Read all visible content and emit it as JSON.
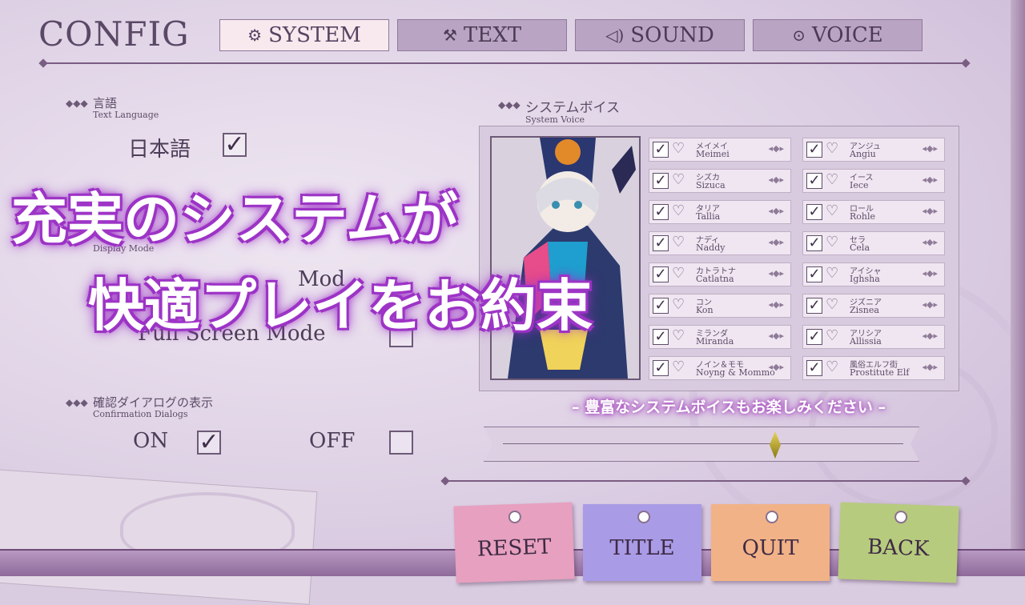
{
  "header": {
    "title": "CONFIG",
    "tabs": [
      {
        "label": "SYSTEM",
        "icon": "gear-icon",
        "active": true
      },
      {
        "label": "TEXT",
        "icon": "hammer-icon",
        "active": false
      },
      {
        "label": "SOUND",
        "icon": "speaker-icon",
        "active": false
      },
      {
        "label": "VOICE",
        "icon": "gamepad-icon",
        "active": false
      }
    ]
  },
  "language": {
    "title_jp": "言語",
    "title_en": "Text Language",
    "option": "日本語",
    "checked": true
  },
  "display": {
    "title_en": "Display Mode",
    "window_partial": "Mod",
    "fullscreen": "Full Screen Mode",
    "fullscreen_checked": false
  },
  "confirm": {
    "title_jp": "確認ダイアログの表示",
    "title_en": "Confirmation Dialogs",
    "on": "ON",
    "off": "OFF",
    "on_checked": true,
    "off_checked": false
  },
  "system_voice": {
    "title_jp": "システムボイス",
    "title_en": "System Voice",
    "items": [
      {
        "jp": "メイメイ",
        "en": "Meimei"
      },
      {
        "jp": "アンジュ",
        "en": "Angiu"
      },
      {
        "jp": "シズカ",
        "en": "Sizuca"
      },
      {
        "jp": "イース",
        "en": "Iece"
      },
      {
        "jp": "タリア",
        "en": "Tallia"
      },
      {
        "jp": "ロール",
        "en": "Rohle"
      },
      {
        "jp": "ナディ",
        "en": "Naddy"
      },
      {
        "jp": "セラ",
        "en": "Cela"
      },
      {
        "jp": "カトラトナ",
        "en": "Catlatna"
      },
      {
        "jp": "アイシャ",
        "en": "Ighsha"
      },
      {
        "jp": "コン",
        "en": "Kon"
      },
      {
        "jp": "ジズニア",
        "en": "Zisnea"
      },
      {
        "jp": "ミランダ",
        "en": "Miranda"
      },
      {
        "jp": "アリシア",
        "en": "Allissia"
      },
      {
        "jp": "ノイン＆モモ",
        "en": "Noyng & Mommo"
      },
      {
        "jp": "風俗エルフ街",
        "en": "Prostitute Elf"
      }
    ],
    "caption": "– 豊富なシステムボイスもお楽しみください –",
    "slider_value": 0.68
  },
  "overlay": {
    "line1": "充実のシステムが",
    "line2": "快適プレイをお約束"
  },
  "buttons": {
    "reset": "RESET",
    "title": "TITLE",
    "quit": "QUIT",
    "back": "BACK"
  },
  "colors": {
    "reset": "#e7a0bf",
    "title": "#a99be6",
    "quit": "#f2b287",
    "back": "#b7cb7e"
  }
}
